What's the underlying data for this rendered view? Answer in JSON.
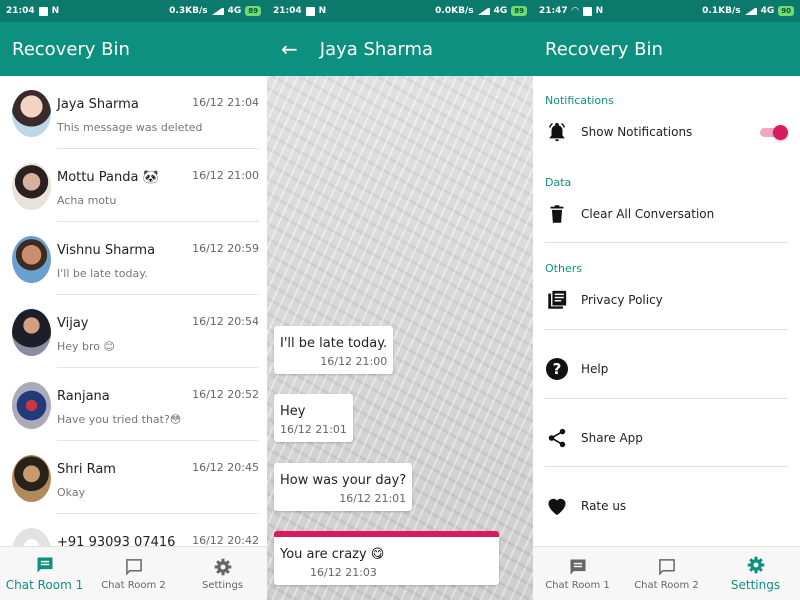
{
  "colors": {
    "primary": "#0e9080",
    "status_bar": "#0b7a6c",
    "accent": "#d81b60"
  },
  "status_bars": [
    {
      "time": "21:04",
      "speed": "0.3KB/s",
      "battery": "89"
    },
    {
      "time": "21:04",
      "speed": "0.0KB/s",
      "battery": "89"
    },
    {
      "time": "21:47",
      "speed": "0.1KB/s",
      "battery": "90"
    }
  ],
  "network": "4G",
  "chat_list": {
    "title": "Recovery Bin",
    "chats": [
      {
        "name": "Jaya Sharma",
        "message": "This message was deleted",
        "time": "16/12 21:04"
      },
      {
        "name": "Mottu Panda 🐼",
        "message": "Acha motu",
        "time": "16/12 21:00"
      },
      {
        "name": "Vishnu Sharma",
        "message": "I'll be late today.",
        "time": "16/12 20:59"
      },
      {
        "name": "Vijay",
        "message": "Hey bro 😊",
        "time": "16/12 20:54"
      },
      {
        "name": "Ranjana",
        "message": "Have you tried that?😳",
        "time": "16/12 20:52"
      },
      {
        "name": "Shri Ram",
        "message": "Okay",
        "time": "16/12 20:45"
      },
      {
        "name": "+91 93093 07416",
        "message": "",
        "time": "16/12 20:42"
      }
    ]
  },
  "chat_view": {
    "title": "Jaya Sharma",
    "messages": [
      {
        "text": "I'll be late today.",
        "time": "16/12 21:00"
      },
      {
        "text": "Hey",
        "time": "16/12 21:01"
      },
      {
        "text": "How was your day?",
        "time": "16/12 21:01"
      },
      {
        "text": "You are crazy 😋",
        "time": "16/12 21:03",
        "deleted": true
      }
    ]
  },
  "settings": {
    "title": "Recovery Bin",
    "sections": [
      {
        "header": "Notifications",
        "items": [
          {
            "label": "Show Notifications",
            "icon": "bell-icon",
            "toggle_on": true
          }
        ]
      },
      {
        "header": "Data",
        "items": [
          {
            "label": "Clear All Conversation",
            "icon": "trash-icon"
          }
        ]
      },
      {
        "header": "Others",
        "items": [
          {
            "label": "Privacy Policy",
            "icon": "document-icon"
          },
          {
            "label": "Help",
            "icon": "help-icon"
          },
          {
            "label": "Share App",
            "icon": "share-icon"
          },
          {
            "label": "Rate us",
            "icon": "heart-icon"
          }
        ]
      }
    ]
  },
  "bottom_nav": {
    "items": [
      {
        "label": "Chat Room 1",
        "icon": "chat-filled-icon"
      },
      {
        "label": "Chat Room 2",
        "icon": "chat-outline-icon"
      },
      {
        "label": "Settings",
        "icon": "gear-icon"
      }
    ],
    "active_panel_1": 0,
    "active_panel_3": 2
  }
}
